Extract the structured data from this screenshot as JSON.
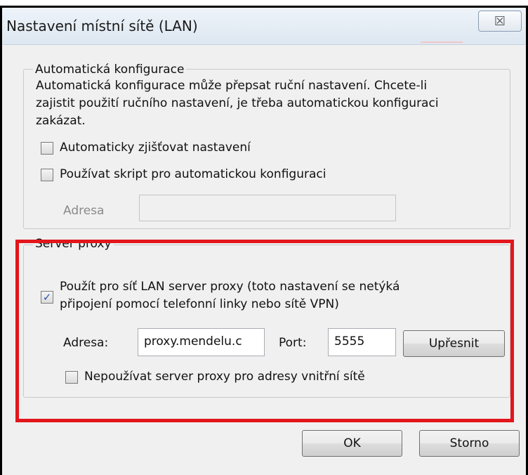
{
  "dialog": {
    "title": "Nastavení místní sítě (LAN)",
    "close_glyph": "☒"
  },
  "auto_config": {
    "legend": "Automatická konfigurace",
    "description_line1": "Automatická konfigurace může přepsat ruční nastavení. Chcete-li",
    "description_line2": "zajistit použití ručního nastavení, je třeba automatickou konfiguraci",
    "description_line3": "zakázat.",
    "detect_label": "Automaticky zjišťovat nastavení",
    "detect_checked": false,
    "script_label": "Používat skript pro automatickou konfiguraci",
    "script_checked": false,
    "address_label": "Adresa",
    "address_value": ""
  },
  "proxy": {
    "legend": "Server proxy",
    "use_proxy_line1": "Použít pro síť LAN server proxy (toto nastavení se netýká",
    "use_proxy_line2": "připojení pomocí telefonní linky nebo sítě VPN)",
    "use_proxy_checked": true,
    "check_glyph": "✓",
    "address_label": "Adresa:",
    "address_value": "proxy.mendelu.c",
    "port_label": "Port:",
    "port_value": "5555",
    "advanced_label": "Upřesnit",
    "bypass_label": "Nepoužívat server proxy pro adresy vnitřní sítě",
    "bypass_checked": false
  },
  "footer": {
    "ok_label": "OK",
    "cancel_label": "Storno"
  },
  "colors": {
    "highlight": "#e2161b",
    "check": "#2b57a8"
  }
}
